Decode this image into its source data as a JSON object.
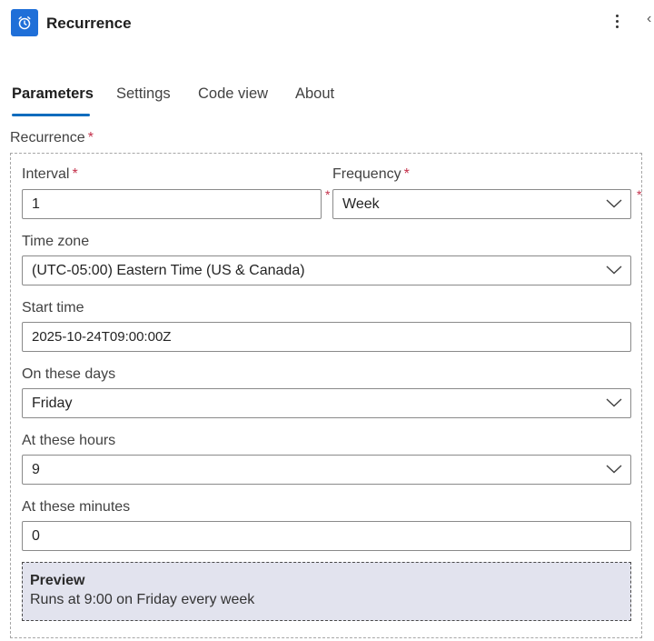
{
  "header": {
    "title": "Recurrence",
    "icon": "alarm-clock-icon",
    "accent": "#1f6fd8"
  },
  "tabs": [
    {
      "label": "Parameters",
      "active": true
    },
    {
      "label": "Settings",
      "active": false
    },
    {
      "label": "Code view",
      "active": false
    },
    {
      "label": "About",
      "active": false
    }
  ],
  "recurrence": {
    "label": "Recurrence",
    "required_marker": "*",
    "interval": {
      "label": "Interval",
      "value": "1"
    },
    "frequency": {
      "label": "Frequency",
      "value": "Week"
    },
    "time_zone": {
      "label": "Time zone",
      "value": "(UTC-05:00) Eastern Time (US & Canada)"
    },
    "start_time": {
      "label": "Start time",
      "value": "2025-10-24T09:00:00Z"
    },
    "on_these_days": {
      "label": "On these days",
      "value": "Friday"
    },
    "at_these_hours": {
      "label": "At these hours",
      "value": "9"
    },
    "at_these_minutes": {
      "label": "At these minutes",
      "value": "0"
    },
    "preview": {
      "title": "Preview",
      "text": "Runs at 9:00 on Friday every week"
    }
  }
}
